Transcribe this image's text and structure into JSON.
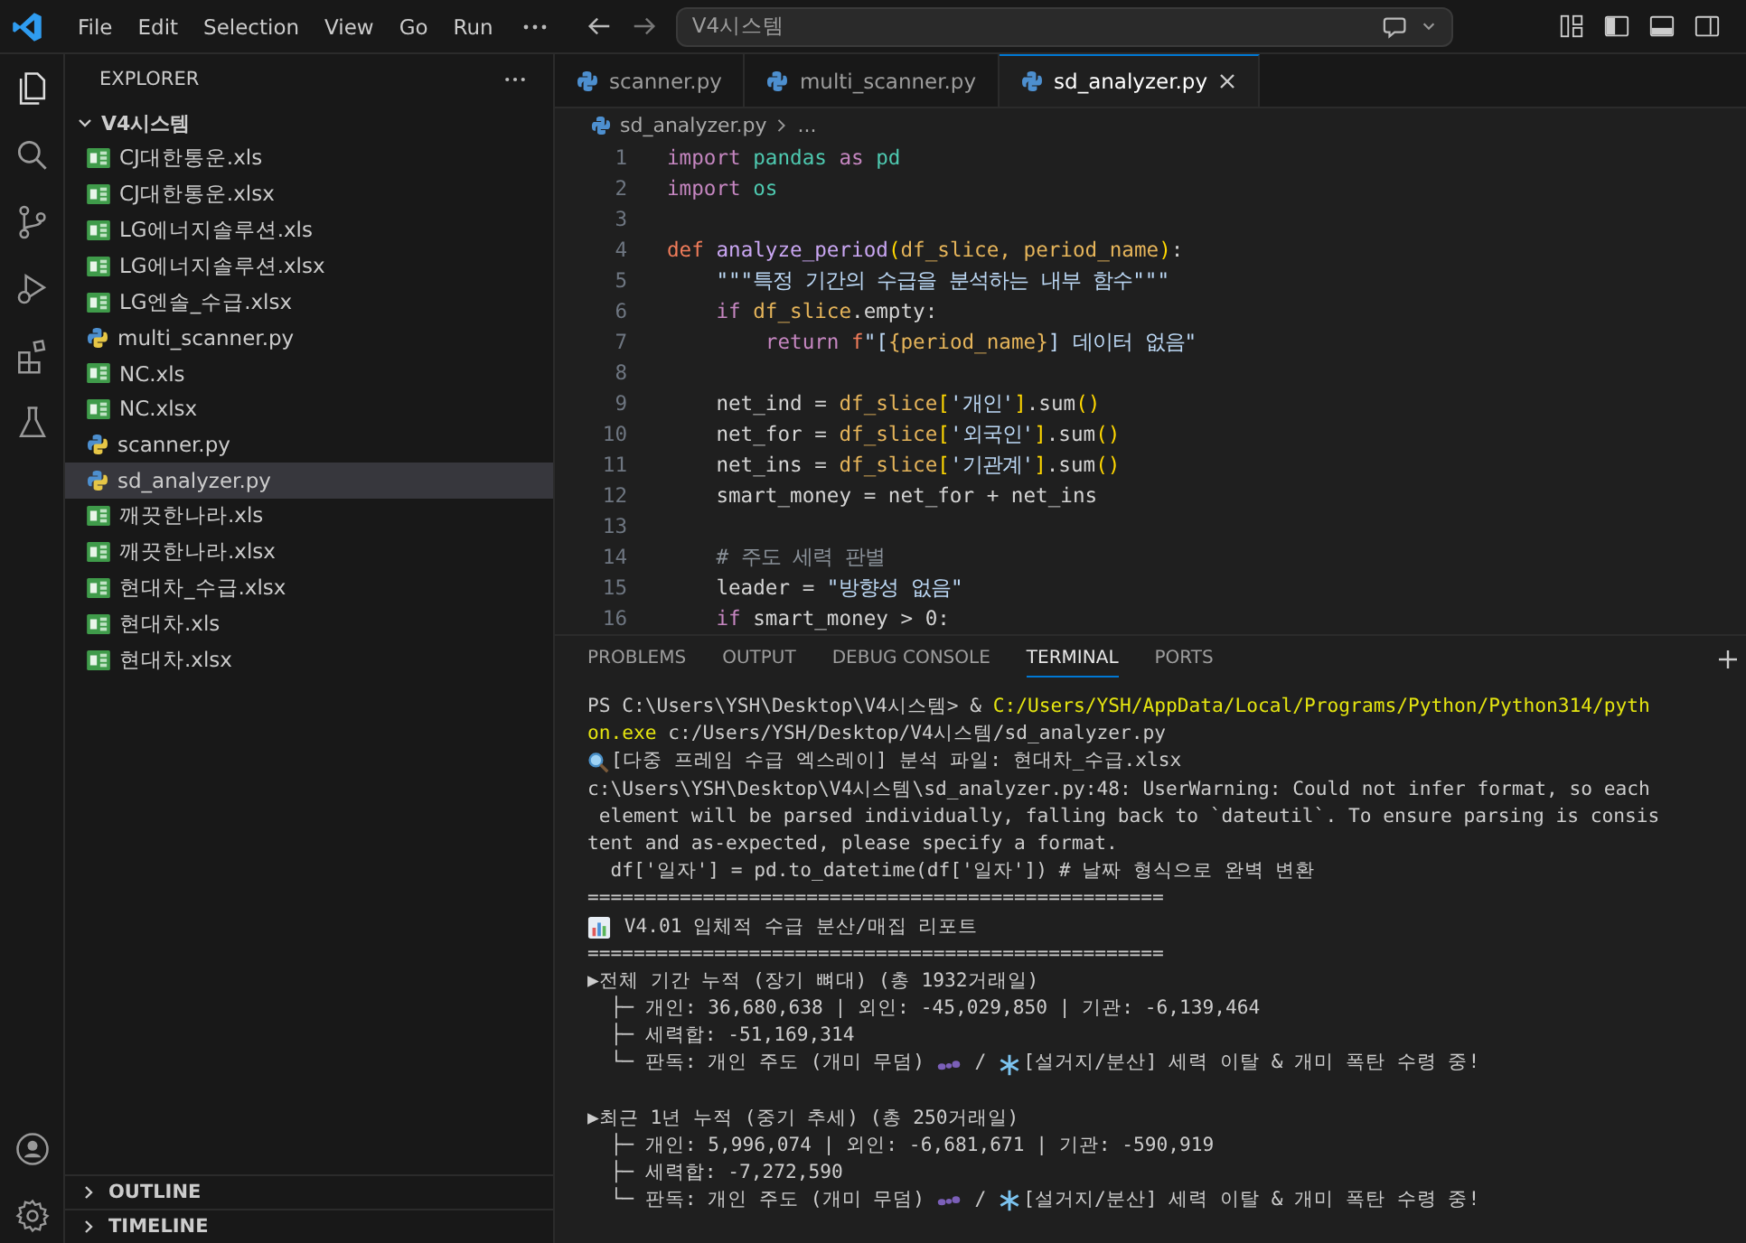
{
  "menu": [
    "File",
    "Edit",
    "Selection",
    "View",
    "Go",
    "Run"
  ],
  "command_center": {
    "text": "V4시스템"
  },
  "explorer": {
    "title": "EXPLORER",
    "folder": {
      "name": "V4시스템",
      "expanded": true
    },
    "files": [
      {
        "name": "CJ대한통운.xls",
        "kind": "excel",
        "selected": false
      },
      {
        "name": "CJ대한통운.xlsx",
        "kind": "excel",
        "selected": false
      },
      {
        "name": "LG에너지솔루션.xls",
        "kind": "excel",
        "selected": false
      },
      {
        "name": "LG에너지솔루션.xlsx",
        "kind": "excel",
        "selected": false
      },
      {
        "name": "LG엔솔_수급.xlsx",
        "kind": "excel",
        "selected": false
      },
      {
        "name": "multi_scanner.py",
        "kind": "python",
        "selected": false
      },
      {
        "name": "NC.xls",
        "kind": "excel",
        "selected": false
      },
      {
        "name": "NC.xlsx",
        "kind": "excel",
        "selected": false
      },
      {
        "name": "scanner.py",
        "kind": "python",
        "selected": false
      },
      {
        "name": "sd_analyzer.py",
        "kind": "python",
        "selected": true
      },
      {
        "name": "깨끗한나라.xls",
        "kind": "excel",
        "selected": false
      },
      {
        "name": "깨끗한나라.xlsx",
        "kind": "excel",
        "selected": false
      },
      {
        "name": "현대차_수급.xlsx",
        "kind": "excel",
        "selected": false
      },
      {
        "name": "현대차.xls",
        "kind": "excel",
        "selected": false
      },
      {
        "name": "현대차.xlsx",
        "kind": "excel",
        "selected": false
      }
    ],
    "sections": [
      {
        "title": "OUTLINE",
        "expanded": false
      },
      {
        "title": "TIMELINE",
        "expanded": false
      }
    ]
  },
  "editor": {
    "tabs": [
      {
        "label": "scanner.py",
        "selected": false
      },
      {
        "label": "multi_scanner.py",
        "selected": false
      },
      {
        "label": "sd_analyzer.py",
        "selected": true
      }
    ],
    "breadcrumb": {
      "file": "sd_analyzer.py",
      "rest": "..."
    },
    "lines": [
      {
        "number": "1",
        "tokens": [
          {
            "kind": "keyword",
            "text": "import "
          },
          {
            "kind": "module",
            "text": "pandas "
          },
          {
            "kind": "keyword",
            "text": "as "
          },
          {
            "kind": "module",
            "text": "pd"
          }
        ]
      },
      {
        "number": "2",
        "tokens": [
          {
            "kind": "keyword",
            "text": "import "
          },
          {
            "kind": "module",
            "text": "os"
          }
        ]
      },
      {
        "number": "3"
      },
      {
        "number": "4",
        "tokens": [
          {
            "kind": "def",
            "text": "def "
          },
          {
            "kind": "func",
            "text": "analyze_period"
          },
          {
            "kind": "bracket",
            "text": "("
          },
          {
            "kind": "param",
            "text": "df_slice, period_name"
          },
          {
            "kind": "bracket",
            "text": ")"
          },
          {
            "kind": "plain",
            "text": ":"
          }
        ]
      },
      {
        "number": "5",
        "tokens": [
          {
            "kind": "string",
            "text": "    \"\"\"특정 기간의 수급을 분석하는 내부 함수\"\"\""
          }
        ]
      },
      {
        "number": "6",
        "tokens": [
          {
            "kind": "keyword",
            "text": "    if "
          },
          {
            "kind": "param",
            "text": "df_slice"
          },
          {
            "kind": "plain",
            "text": ".empty:"
          }
        ]
      },
      {
        "number": "7",
        "tokens": [
          {
            "kind": "keyword",
            "text": "        return "
          },
          {
            "kind": "def",
            "text": "f"
          },
          {
            "kind": "string",
            "text": "\"["
          },
          {
            "kind": "param",
            "text": "{period_name}"
          },
          {
            "kind": "string",
            "text": "] 데이터 없음\""
          }
        ]
      },
      {
        "number": "8"
      },
      {
        "number": "9",
        "tokens": [
          {
            "kind": "plain",
            "text": "    net_ind = "
          },
          {
            "kind": "param",
            "text": "df_slice"
          },
          {
            "kind": "bracket",
            "text": "["
          },
          {
            "kind": "string",
            "text": "'개인'"
          },
          {
            "kind": "bracket",
            "text": "]"
          },
          {
            "kind": "plain",
            "text": ".sum"
          },
          {
            "kind": "bracket",
            "text": "()"
          }
        ]
      },
      {
        "number": "10",
        "tokens": [
          {
            "kind": "plain",
            "text": "    net_for = "
          },
          {
            "kind": "param",
            "text": "df_slice"
          },
          {
            "kind": "bracket",
            "text": "["
          },
          {
            "kind": "string",
            "text": "'외국인'"
          },
          {
            "kind": "bracket",
            "text": "]"
          },
          {
            "kind": "plain",
            "text": ".sum"
          },
          {
            "kind": "bracket",
            "text": "()"
          }
        ]
      },
      {
        "number": "11",
        "tokens": [
          {
            "kind": "plain",
            "text": "    net_ins = "
          },
          {
            "kind": "param",
            "text": "df_slice"
          },
          {
            "kind": "bracket",
            "text": "["
          },
          {
            "kind": "string",
            "text": "'기관계'"
          },
          {
            "kind": "bracket",
            "text": "]"
          },
          {
            "kind": "plain",
            "text": ".sum"
          },
          {
            "kind": "bracket",
            "text": "()"
          }
        ]
      },
      {
        "number": "12",
        "tokens": [
          {
            "kind": "plain",
            "text": "    smart_money = net_for + net_ins"
          }
        ]
      },
      {
        "number": "13"
      },
      {
        "number": "14",
        "tokens": [
          {
            "kind": "comment",
            "text": "    # 주도 세력 판별"
          }
        ]
      },
      {
        "number": "15",
        "tokens": [
          {
            "kind": "plain",
            "text": "    leader = "
          },
          {
            "kind": "string",
            "text": "\"방향성 없음\""
          }
        ]
      },
      {
        "number": "16",
        "tokens": [
          {
            "kind": "keyword",
            "text": "    if "
          },
          {
            "kind": "plain",
            "text": "smart_money > 0:"
          }
        ]
      }
    ]
  },
  "panel": {
    "tabs": [
      {
        "label": "PROBLEMS",
        "selected": false
      },
      {
        "label": "OUTPUT",
        "selected": false
      },
      {
        "label": "DEBUG CONSOLE",
        "selected": false
      },
      {
        "label": "TERMINAL",
        "selected": true
      },
      {
        "label": "PORTS",
        "selected": false
      }
    ],
    "terminal": [
      {
        "gap_before": false,
        "segments": [
          {
            "kind": "text",
            "text": "PS C:\\Users\\YSH\\Desktop\\V4시스템> & "
          },
          {
            "kind": "path",
            "text": "C:/Users/YSH/AppData/Local/Programs/Python/Python314/pyth"
          }
        ]
      },
      {
        "gap_before": false,
        "segments": [
          {
            "kind": "path",
            "text": "on.exe"
          },
          {
            "kind": "text",
            "text": " c:/Users/YSH/Desktop/V4시스템/sd_analyzer.py"
          }
        ]
      },
      {
        "gap_before": false,
        "segments": [
          {
            "kind": "search-mark"
          },
          {
            "kind": "text",
            "text": "[다중 프레임 수급 엑스레이] 분석 파일: 현대차_수급.xlsx"
          }
        ]
      },
      {
        "gap_before": false,
        "segments": [
          {
            "kind": "text",
            "text": "c:\\Users\\YSH\\Desktop\\V4시스템\\sd_analyzer.py:48: UserWarning: Could not infer format, so each"
          }
        ]
      },
      {
        "gap_before": false,
        "segments": [
          {
            "kind": "text",
            "text": " element will be parsed individually, falling back to `dateutil`. To ensure parsing is consis"
          }
        ]
      },
      {
        "gap_before": false,
        "segments": [
          {
            "kind": "text",
            "text": "tent and as-expected, please specify a format."
          }
        ]
      },
      {
        "gap_before": false,
        "segments": [
          {
            "kind": "text",
            "text": "  df['일자'] = pd.to_datetime(df['일자']) # 날짜 형식으로 완벽 변환"
          }
        ]
      },
      {
        "gap_before": false,
        "segments": [
          {
            "kind": "text",
            "text": "=================================================="
          }
        ]
      },
      {
        "gap_before": false,
        "segments": [
          {
            "kind": "chart-mark"
          },
          {
            "kind": "text",
            "text": " V4.01 입체적 수급 분산/매집 리포트"
          }
        ]
      },
      {
        "gap_before": false,
        "segments": [
          {
            "kind": "text",
            "text": "=================================================="
          }
        ]
      },
      {
        "gap_before": false,
        "segments": [
          {
            "kind": "text",
            "text": "▶전체 기간 누적 (장기 뼈대) (총 1932거래일)"
          }
        ]
      },
      {
        "gap_before": false,
        "segments": [
          {
            "kind": "text",
            "text": "  ├─ 개인: 36,680,638 | 외인: -45,029,850 | 기관: -6,139,464"
          }
        ]
      },
      {
        "gap_before": false,
        "segments": [
          {
            "kind": "text",
            "text": "  ├─ 세력합: -51,169,314"
          }
        ]
      },
      {
        "gap_before": false,
        "segments": [
          {
            "kind": "text",
            "text": "  └─ 판독: 개인 주도 (개미 무덤) "
          },
          {
            "kind": "ant-mark"
          },
          {
            "kind": "text",
            "text": " / "
          },
          {
            "kind": "snow-mark"
          },
          {
            "kind": "text",
            "text": "[설거지/분산] 세력 이탈 & 개미 폭탄 수령 중!"
          }
        ]
      },
      {
        "gap_before": true,
        "segments": [
          {
            "kind": "text",
            "text": "▶최근 1년 누적 (중기 추세) (총 250거래일)"
          }
        ]
      },
      {
        "gap_before": false,
        "segments": [
          {
            "kind": "text",
            "text": "  ├─ 개인: 5,996,074 | 외인: -6,681,671 | 기관: -590,919"
          }
        ]
      },
      {
        "gap_before": false,
        "segments": [
          {
            "kind": "text",
            "text": "  ├─ 세력합: -7,272,590"
          }
        ]
      },
      {
        "gap_before": false,
        "segments": [
          {
            "kind": "text",
            "text": "  └─ 판독: 개인 주도 (개미 무덤) "
          },
          {
            "kind": "ant-mark"
          },
          {
            "kind": "text",
            "text": " / "
          },
          {
            "kind": "snow-mark"
          },
          {
            "kind": "text",
            "text": "[설거지/분산] 세력 이탈 & 개미 폭탄 수령 중!"
          }
        ]
      }
    ]
  }
}
